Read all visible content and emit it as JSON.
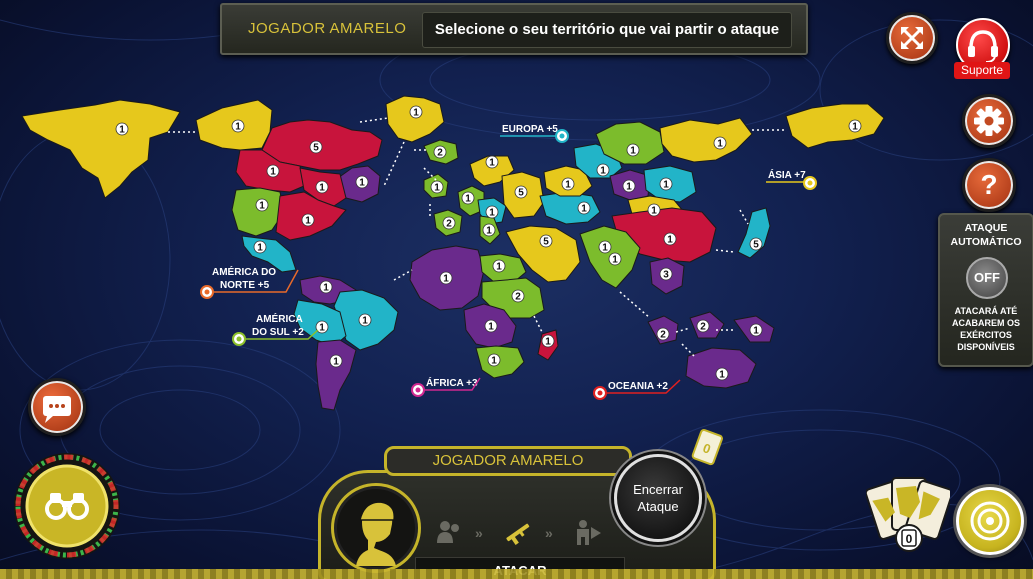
{
  "banner": {
    "player": "JOGADOR AMARELO",
    "message": "Selecione o seu território que vai partir o ataque"
  },
  "buttons": {
    "fullscreen_icon": "expand-arrows-icon",
    "support_label": "Suporte",
    "settings_icon": "gear-icon",
    "help_label": "?"
  },
  "auto_attack": {
    "title": "ATAQUE AUTOMÁTICO",
    "toggle": "OFF",
    "description": "ATACARÁ ATÉ ACABAREM OS EXÉRCITOS DISPONÍVEIS"
  },
  "continents": {
    "europa": "EUROPA +5",
    "asia": "ÁSIA +7",
    "america_norte_l1": "AMÉRICA DO",
    "america_norte_l2": "NORTE +5",
    "america_sul_l1": "AMÉRICA",
    "america_sul_l2": "DO SUL +2",
    "africa": "ÁFRICA +3",
    "oceania": "OCEANIA +2"
  },
  "colors": {
    "yellow": "#e6c81c",
    "red": "#c8143c",
    "green": "#7cbc2c",
    "cyan": "#22b4c8",
    "purple": "#6a2a8c"
  },
  "territories": [
    {
      "name": "alaska",
      "color": "yellow",
      "armies": "1"
    },
    {
      "name": "mackenzie",
      "color": "yellow",
      "armies": "1"
    },
    {
      "name": "vancouver",
      "color": "red",
      "armies": "1"
    },
    {
      "name": "ottawa",
      "color": "red",
      "armies": "5"
    },
    {
      "name": "labrador",
      "color": "purple",
      "armies": "1"
    },
    {
      "name": "groenlandia",
      "color": "yellow",
      "armies": "1"
    },
    {
      "name": "california",
      "color": "green",
      "armies": "1"
    },
    {
      "name": "nova-york",
      "color": "red",
      "armies": "1"
    },
    {
      "name": "mexico",
      "color": "cyan",
      "armies": "1"
    },
    {
      "name": "quebec-2",
      "color": "red",
      "armies": "1"
    },
    {
      "name": "colombia",
      "color": "purple",
      "armies": "1"
    },
    {
      "name": "brasil",
      "color": "cyan",
      "armies": "1"
    },
    {
      "name": "peru",
      "color": "cyan",
      "armies": "1"
    },
    {
      "name": "argentina",
      "color": "purple",
      "armies": "1"
    },
    {
      "name": "islandia",
      "color": "green",
      "armies": "2"
    },
    {
      "name": "inglaterra",
      "color": "green",
      "armies": "1"
    },
    {
      "name": "portugal",
      "color": "green",
      "armies": "2"
    },
    {
      "name": "franca",
      "color": "green",
      "armies": "1"
    },
    {
      "name": "alemanha",
      "color": "cyan",
      "armies": "1"
    },
    {
      "name": "suecia",
      "color": "yellow",
      "armies": "1"
    },
    {
      "name": "polonia",
      "color": "yellow",
      "armies": "5"
    },
    {
      "name": "moscou",
      "color": "yellow",
      "armies": "1"
    },
    {
      "name": "italia",
      "color": "green",
      "armies": "1"
    },
    {
      "name": "argelia",
      "color": "purple",
      "armies": "1"
    },
    {
      "name": "egito",
      "color": "green",
      "armies": "1"
    },
    {
      "name": "sudao",
      "color": "green",
      "armies": "2"
    },
    {
      "name": "congo",
      "color": "purple",
      "armies": "1"
    },
    {
      "name": "africa-sul",
      "color": "green",
      "armies": "1"
    },
    {
      "name": "madagascar",
      "color": "red",
      "armies": "1"
    },
    {
      "name": "oriente-medio",
      "color": "yellow",
      "armies": "5"
    },
    {
      "name": "omsk",
      "color": "cyan",
      "armies": "1"
    },
    {
      "name": "dudinka",
      "color": "purple",
      "armies": "1"
    },
    {
      "name": "siberia",
      "color": "green",
      "armies": "1"
    },
    {
      "name": "tchita",
      "color": "cyan",
      "armies": "1"
    },
    {
      "name": "vladivostok",
      "color": "yellow",
      "armies": "1"
    },
    {
      "name": "aral",
      "color": "cyan",
      "armies": "1"
    },
    {
      "name": "mongolia",
      "color": "yellow",
      "armies": "1"
    },
    {
      "name": "china",
      "color": "red",
      "armies": "1"
    },
    {
      "name": "india",
      "color": "green",
      "armies": "1"
    },
    {
      "name": "vietna",
      "color": "purple",
      "armies": "3"
    },
    {
      "name": "japao",
      "color": "cyan",
      "armies": "5"
    },
    {
      "name": "kamchatka",
      "color": "yellow",
      "armies": "1"
    },
    {
      "name": "sumatra",
      "color": "purple",
      "armies": "2"
    },
    {
      "name": "borneo",
      "color": "purple",
      "armies": "2"
    },
    {
      "name": "nova-guine",
      "color": "purple",
      "armies": "1"
    },
    {
      "name": "australia",
      "color": "purple",
      "armies": "1"
    },
    {
      "name": "oriente-medio-2",
      "color": "green",
      "armies": "1"
    }
  ],
  "bottom_panel": {
    "player": "JOGADOR AMARELO",
    "end_turn_l1": "Encerrar",
    "end_turn_l2": "Ataque",
    "phase": "ATACAR",
    "cards_small": "0",
    "cards_count": "0"
  }
}
